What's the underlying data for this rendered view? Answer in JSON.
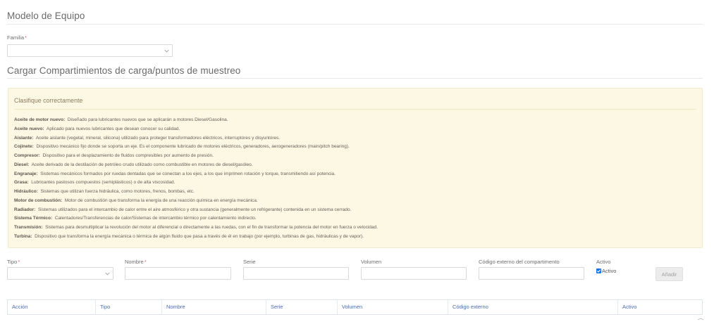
{
  "page": {
    "title": "Modelo de Equipo",
    "section_title": "Cargar Compartimientos de carga/puntos de muestreo"
  },
  "familia": {
    "label": "Familia",
    "required_mark": "*",
    "value": ""
  },
  "info": {
    "title": "Clasifique correctamente",
    "items": [
      {
        "term": "Aceite de motor nuevo:",
        "desc": "Diseñado para lubricantes nuevos que se aplicarán a motores Diesel/Gasolina."
      },
      {
        "term": "Aceite nuevo:",
        "desc": "Aplicado para nuevos lubricantes que desean conocer su calidad."
      },
      {
        "term": "Aislante:",
        "desc": "Aceite aislante (vegetal, mineral, silicona) utilizado para proteger transformadores eléctricos, interruptores y disyuntores."
      },
      {
        "term": "Cojinete:",
        "desc": "Dispositivo mecánico fijo donde se soporta un eje. Es el componente lubricado de motores eléctricos, generadores, aerogeneradores (main/pitch bearing)."
      },
      {
        "term": "Compresor:",
        "desc": "Dispositivo para el desplazamiento de fluidos compresibles por aumento de presión."
      },
      {
        "term": "Diesel:",
        "desc": "Aceite derivado de la destilación de petróleo crudo utilizado como combustible en motores de diesel/gasóleo."
      },
      {
        "term": "Engranaje:",
        "desc": "Sistemas mecánicos formados por ruedas dentadas que se conectan a los ejes, a los que imprimen rotación y torque, transmitiendo así potencia."
      },
      {
        "term": "Grasa:",
        "desc": "Lubricantes pastosos compuestos (semiplásticos) o de alta viscosidad."
      },
      {
        "term": "Hidráulico:",
        "desc": "Sistemas que utilizan fuerza hidráulica, como motores, frenos, bombas, etc."
      },
      {
        "term": "Motor de combustión:",
        "desc": "Motor de combustión que transforma la energía de una reacción química en energía mecánica."
      },
      {
        "term": "Radiador:",
        "desc": "Sistemas utilizados para el intercambio de calor entre el aire atmosférico y otra sustancia (generalmente un refrigerante) contenida en un sistema cerrado."
      },
      {
        "term": "Sistema Térmico:",
        "desc": "Calentadores/Transferencias de calor/Sistemas de intercambio térmico por calentamiento indirecto."
      },
      {
        "term": "Transmisión:",
        "desc": "Sistemas para desmultiplicar la revolución del motor al diferencial o directamente a las ruedas, con el fin de transformar la potencia del motor en fuerza o velocidad."
      },
      {
        "term": "Turbina:",
        "desc": "Dispositivo que transforma la energía mecánica o térmica de algún fluido que pasa a través de él en trabajo (por ejemplo, turbinas de gas, hidráulicas y de vapor)."
      }
    ]
  },
  "form": {
    "tipo_label": "Tipo",
    "nombre_label": "Nombre",
    "serie_label": "Serie",
    "volumen_label": "Volumen",
    "codigo_label": "Código externo del compartimento",
    "activo_label": "Activo",
    "activo_check_label": "Activo",
    "activo_checked": true,
    "required_mark": "*",
    "add_button": "Añadir"
  },
  "table": {
    "columns": [
      "Acción",
      "Tipo",
      "Nombre",
      "Serie",
      "Volumen",
      "Código externo",
      "Activo"
    ]
  },
  "colors": {
    "info_bg": "#fcf8e3",
    "header_text": "#4a6da7",
    "checkbox": "#1a73e8"
  }
}
